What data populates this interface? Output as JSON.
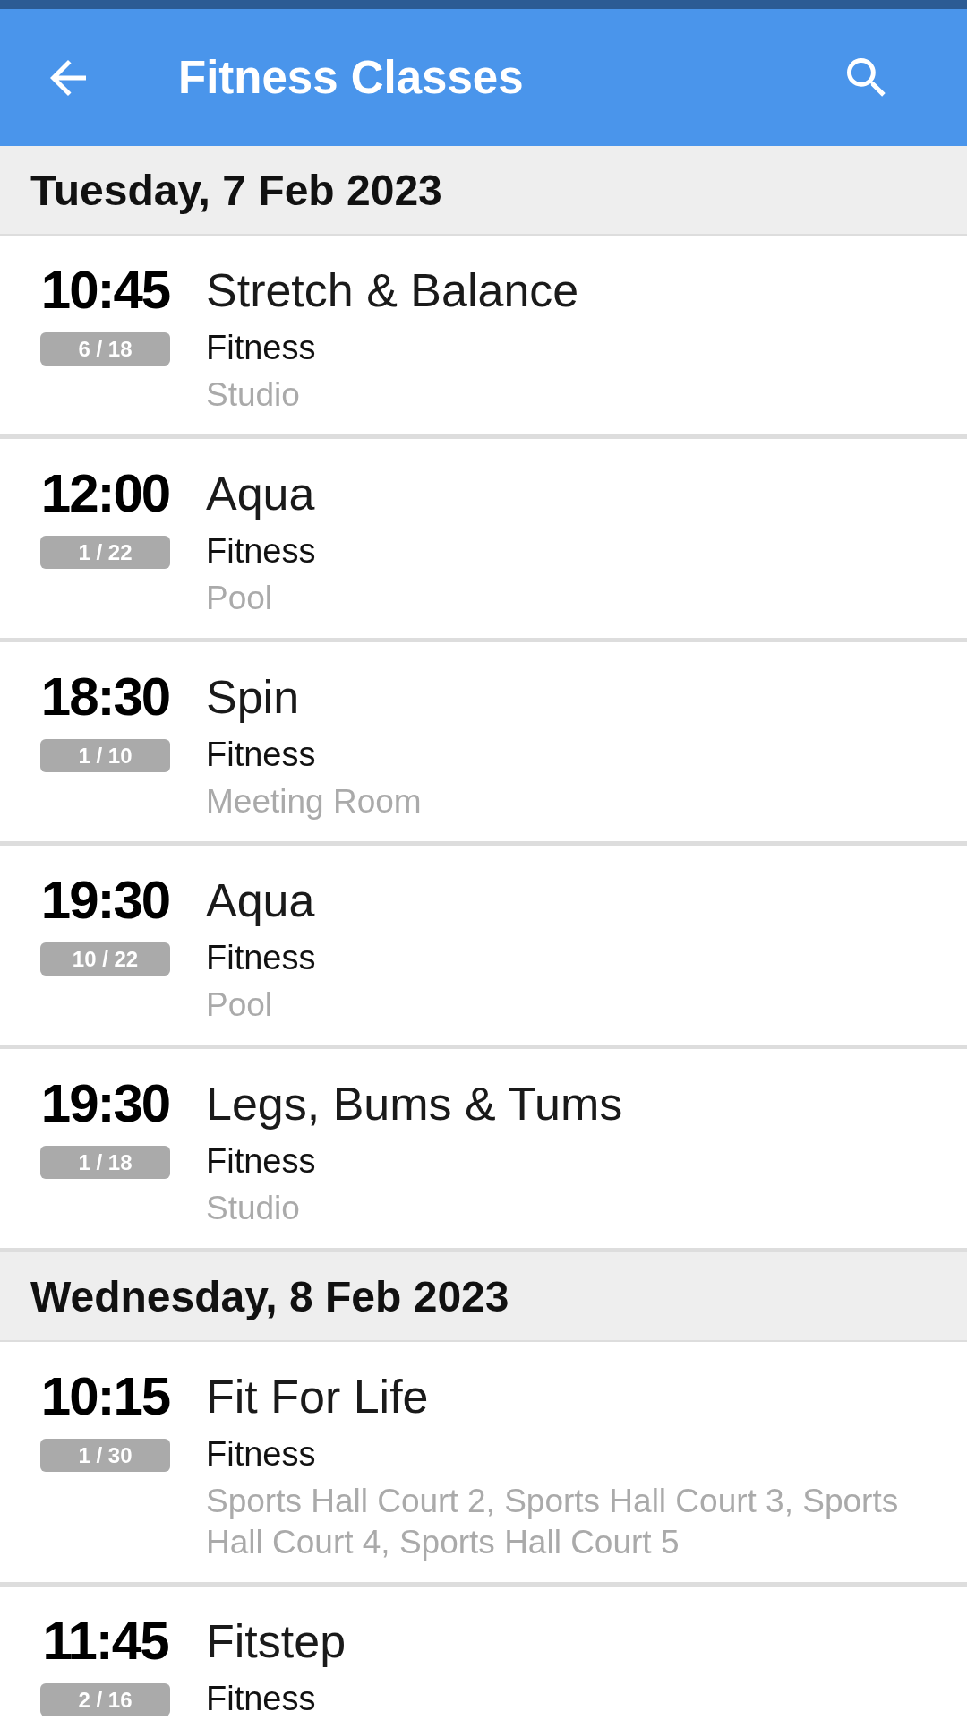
{
  "app_bar": {
    "title": "Fitness Classes"
  },
  "days": [
    {
      "date": "Tuesday, 7 Feb 2023",
      "classes": [
        {
          "time": "10:45",
          "spaces": "6 / 18",
          "name": "Stretch & Balance",
          "category": "Fitness",
          "location": "Studio"
        },
        {
          "time": "12:00",
          "spaces": "1 / 22",
          "name": "Aqua",
          "category": "Fitness",
          "location": "Pool"
        },
        {
          "time": "18:30",
          "spaces": "1 / 10",
          "name": "Spin",
          "category": "Fitness",
          "location": "Meeting Room"
        },
        {
          "time": "19:30",
          "spaces": "10 / 22",
          "name": "Aqua",
          "category": "Fitness",
          "location": "Pool"
        },
        {
          "time": "19:30",
          "spaces": "1 / 18",
          "name": "Legs, Bums & Tums",
          "category": "Fitness",
          "location": "Studio"
        }
      ]
    },
    {
      "date": "Wednesday, 8 Feb 2023",
      "classes": [
        {
          "time": "10:15",
          "spaces": "1 / 30",
          "name": "Fit For Life",
          "category": "Fitness",
          "location": "Sports Hall Court 2, Sports Hall Court 3, Sports Hall Court 4, Sports Hall Court 5"
        },
        {
          "time": "11:45",
          "spaces": "2 / 16",
          "name": "Fitstep",
          "category": "Fitness"
        }
      ]
    }
  ]
}
